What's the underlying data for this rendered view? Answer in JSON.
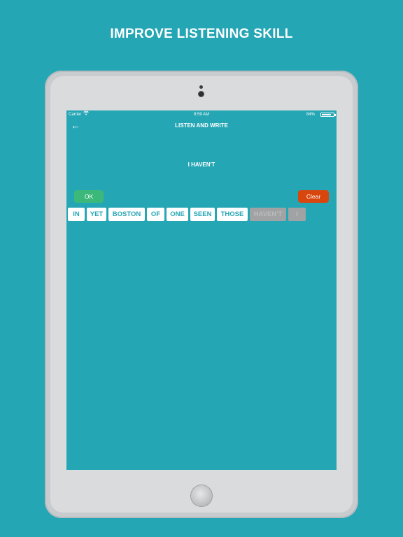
{
  "headline": "IMPROVE LISTENING SKILL",
  "status_bar": {
    "carrier": "Carrier",
    "wifi_icon": "wifi-icon",
    "time": "9:59 AM",
    "battery": "84%",
    "battery_level": 0.84
  },
  "nav": {
    "back_icon": "back-arrow-icon",
    "back_glyph": "←",
    "title": "LISTEN AND WRITE"
  },
  "answer_text": "I HAVEN'T",
  "ok_label": "OK",
  "clear_label": "Clear",
  "colors": {
    "background": "#25a6b4",
    "ok": "#3cb97a",
    "clear": "#d8460e",
    "used_word": "#a0a2a4"
  },
  "words": [
    {
      "text": "IN",
      "used": false
    },
    {
      "text": "YET",
      "used": false
    },
    {
      "text": "BOSTON",
      "used": false
    },
    {
      "text": "OF",
      "used": false
    },
    {
      "text": "ONE",
      "used": false
    },
    {
      "text": "SEEN",
      "used": false
    },
    {
      "text": "THOSE",
      "used": false
    },
    {
      "text": "HAVEN'T",
      "used": true
    },
    {
      "text": "I",
      "used": true
    }
  ]
}
